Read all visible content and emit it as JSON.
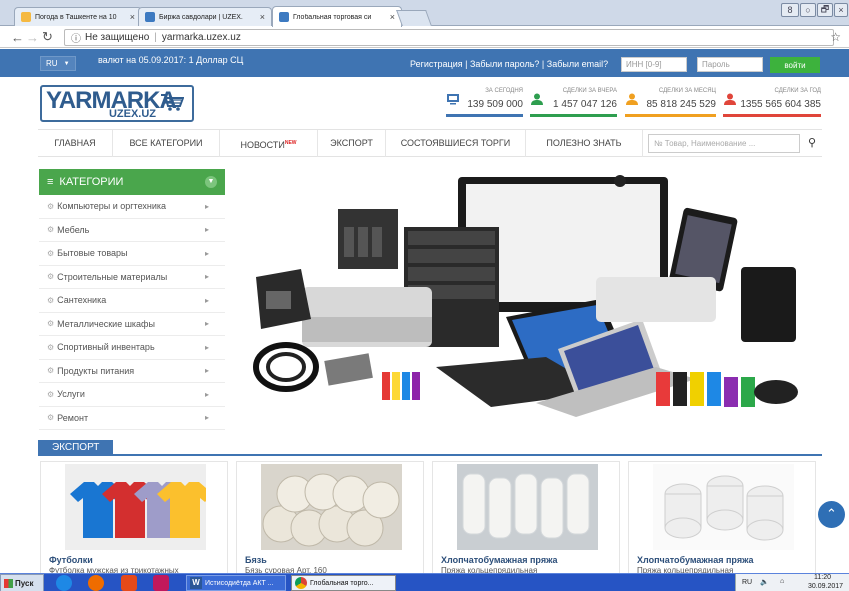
{
  "browser": {
    "tabs": [
      {
        "label": "Погода в Ташкенте на 10",
        "active": false,
        "icon": "weather-favicon"
      },
      {
        "label": "Биржа савдолари | UZEX.",
        "active": false,
        "icon": "uzex-favicon"
      },
      {
        "label": "Глобальная торговая си",
        "active": true,
        "icon": "uzex-favicon"
      }
    ],
    "tab_close": "×",
    "url_security": "Не защищено",
    "url": "yarmarka.uzex.uz",
    "window_controls": [
      "8",
      "○",
      "🗗",
      "×"
    ]
  },
  "topbar": {
    "lang": "RU",
    "rate": "валют на 05.09.2017: 1 Доллар СЦ",
    "links": "Регистрация | Забыли пароль? | Забыли email?",
    "inn_placeholder": "ИНН [0-9]",
    "password_placeholder": "Пароль",
    "login": "войти"
  },
  "logo": {
    "main": "YARMARKA",
    "sub": "UZEX.UZ"
  },
  "stats": [
    {
      "label": "ЗА СЕГОДНЯ",
      "value": "139 509 000",
      "color": "#3f74b2",
      "icon": "monitor-icon"
    },
    {
      "label": "СДЕЛКИ ЗА ВЧЕРА",
      "value": "1 457 047 126",
      "color": "#2e9e4f",
      "icon": "person-icon"
    },
    {
      "label": "СДЕЛКИ ЗА МЕСЯЦ",
      "value": "85 818 245 529",
      "color": "#f0a020",
      "icon": "person-icon"
    },
    {
      "label": "СДЕЛКИ ЗА ГОД",
      "value": "1355 565 604 385",
      "color": "#e0453a",
      "icon": "person-icon"
    }
  ],
  "nav": {
    "items": [
      "ГЛАВНАЯ",
      "ВСЕ КАТЕГОРИИ",
      "НОВОСТИ",
      "ЭКСПОРТ",
      "СОСТОЯВШИЕСЯ ТОРГИ",
      "ПОЛЕЗНО ЗНАТЬ"
    ],
    "new_badge": "NEW",
    "search_placeholder": "№ Товар, Наименование ..."
  },
  "categories": {
    "title": "КАТЕГОРИИ",
    "items": [
      "Компьютеры и оргтехника",
      "Мебель",
      "Бытовые товары",
      "Строительные материалы",
      "Сантехника",
      "Металлические шкафы",
      "Спортивный инвентарь",
      "Продукты питания",
      "Услуги",
      "Ремонт"
    ]
  },
  "export": {
    "title": "ЭКСПОРТ",
    "products": [
      {
        "name": "Футболки",
        "desc": "Футболка мужская из трикотажных"
      },
      {
        "name": "Бязь",
        "desc": "Бязь суровая Арт. 160"
      },
      {
        "name": "Хлопчатобумажная пряжа",
        "desc": "Пряжа кольцепрядильная"
      },
      {
        "name": "Хлопчатобумажная пряжа",
        "desc": "Пряжа кольцепрядильная"
      }
    ]
  },
  "taskbar": {
    "start": "Пуск",
    "tasks": [
      "Истисодиётда АКТ ...",
      "Глобальная торго..."
    ],
    "tray_lang": "RU",
    "time": "11:20",
    "date": "30.09.2017"
  }
}
